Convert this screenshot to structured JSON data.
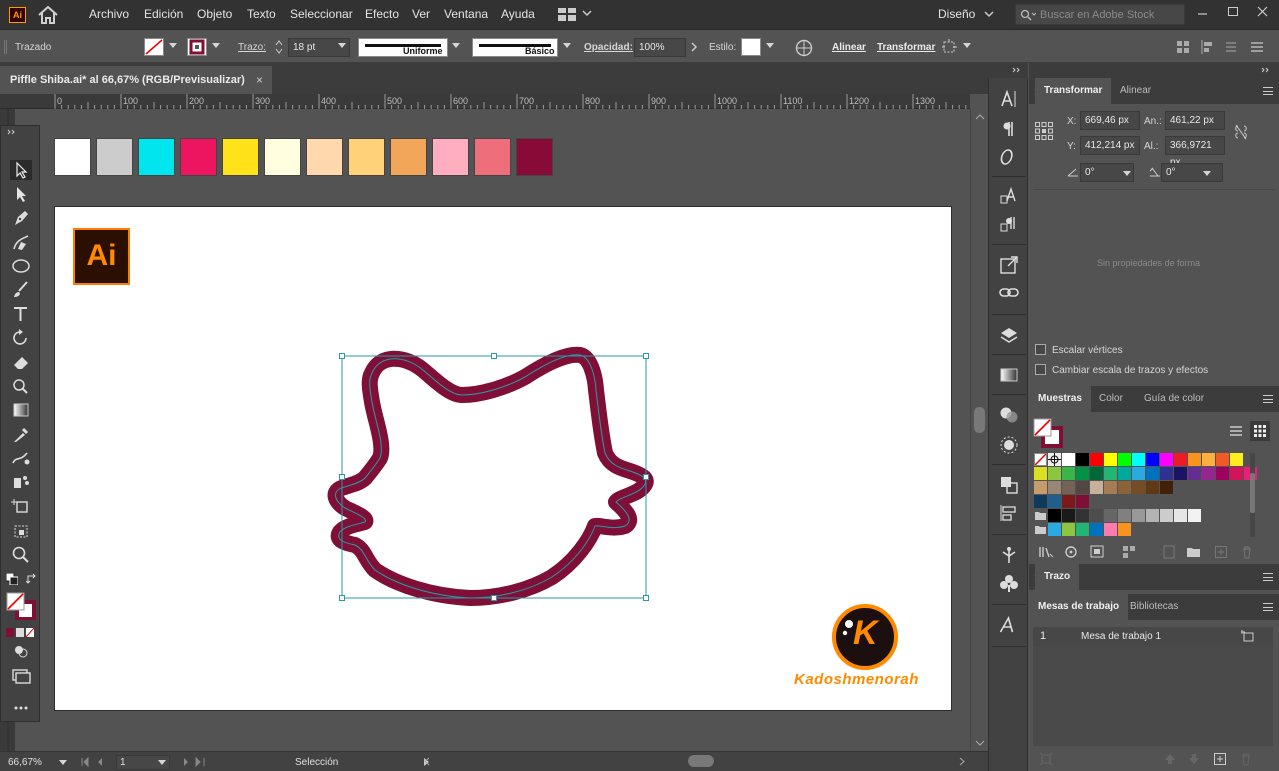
{
  "app": {
    "logo": "Ai"
  },
  "menu": [
    "Archivo",
    "Edición",
    "Objeto",
    "Texto",
    "Seleccionar",
    "Efecto",
    "Ver",
    "Ventana",
    "Ayuda"
  ],
  "workspace": "Diseño",
  "search": {
    "placeholder": "Buscar en Adobe Stock"
  },
  "control": {
    "selection_type": "Trazado",
    "stroke_label": "Trazo:",
    "stroke_weight": "18 pt",
    "profile": "Uniforme",
    "brush": "Básico",
    "opacity_label": "Opacidad:",
    "opacity": "100%",
    "style_label": "Estilo:",
    "align_link": "Alinear",
    "transform_link": "Transformar"
  },
  "document": {
    "tab_title": "Piffle Shiba.ai* al 66,67% (RGB/Previsualizar)",
    "close": "×"
  },
  "ruler": {
    "ticks": [
      "0",
      "100",
      "200",
      "300",
      "400",
      "500",
      "600",
      "700",
      "800",
      "900",
      "1000",
      "1100",
      "1200",
      "1300"
    ]
  },
  "palette": {
    "colors": [
      "#ffffff",
      "#cccccc",
      "#00e5ee",
      "#ee1560",
      "#ffe21a",
      "#ffffe0",
      "#ffd9ad",
      "#ffd27a",
      "#f2a65a",
      "#ffaebf",
      "#ee6f7b",
      "#880a36"
    ]
  },
  "artwork": {
    "stroke_color": "#7f0f36",
    "selection_color": "#2b9aa6",
    "logo_text": "Ai",
    "watermark_letter": "K",
    "watermark_text": "Kadoshmenorah"
  },
  "status": {
    "zoom": "66,67%",
    "artboard_num": "1",
    "tool": "Selección"
  },
  "panels": {
    "transform_tabs": [
      "Transformar",
      "Alinear"
    ],
    "x_label": "X:",
    "x": "669,46 px",
    "y_label": "Y:",
    "y": "412,214 px",
    "w_label": "An.:",
    "w": "461,22 px",
    "h_label": "Al.:",
    "h": "366,9721 px",
    "angle": "0°",
    "shear": "0°",
    "no_shape": "Sin propiedades de forma",
    "scale_corners": "Escalar vértices",
    "scale_strokes": "Cambiar escala de trazos y efectos",
    "swatch_tabs": [
      "Muestras",
      "Color",
      "Guía de color"
    ],
    "stroke_panel": "Trazo",
    "artboard_tabs": [
      "Mesas de trabajo",
      "Bibliotecas"
    ],
    "artboards": [
      {
        "num": "1",
        "name": "Mesa de trabajo 1"
      }
    ]
  },
  "swatches": {
    "row1": [
      "#ffffff",
      "#000000",
      "#ff0000",
      "#ffff00",
      "#00ff00",
      "#00ffff",
      "#0000ff",
      "#ff00ff",
      "#ed1c24",
      "#f7941d",
      "#fbb040",
      "#f15a24",
      "#fcee21"
    ],
    "row2": [
      "#d9e021",
      "#8cc63f",
      "#39b54a",
      "#009245",
      "#006837",
      "#22b573",
      "#00a99d",
      "#29abe2",
      "#0071bc",
      "#2e3192",
      "#1b1464",
      "#662d91",
      "#93278f",
      "#9e005d",
      "#d4145a",
      "#ed1e79"
    ],
    "row3": [
      "#c69c6d",
      "#998675",
      "#736357",
      "#534741",
      "#c7b299",
      "#a67c52",
      "#8c6239",
      "#754c24",
      "#603813",
      "#42210b"
    ],
    "row4": [
      "#0e3b5c",
      "#1e5f8c",
      "#7a1a1a",
      "#7f0f36"
    ],
    "row5": [
      "#000000",
      "#1a1a1a",
      "#333333",
      "#4d4d4d",
      "#666666",
      "#808080",
      "#999999",
      "#b3b3b3",
      "#cccccc",
      "#e6e6e6",
      "#f2f2f2"
    ],
    "row6": [
      "#29abe2",
      "#8cc63f",
      "#22b573",
      "#0071bc",
      "#ff7bac",
      "#f7931e"
    ]
  }
}
